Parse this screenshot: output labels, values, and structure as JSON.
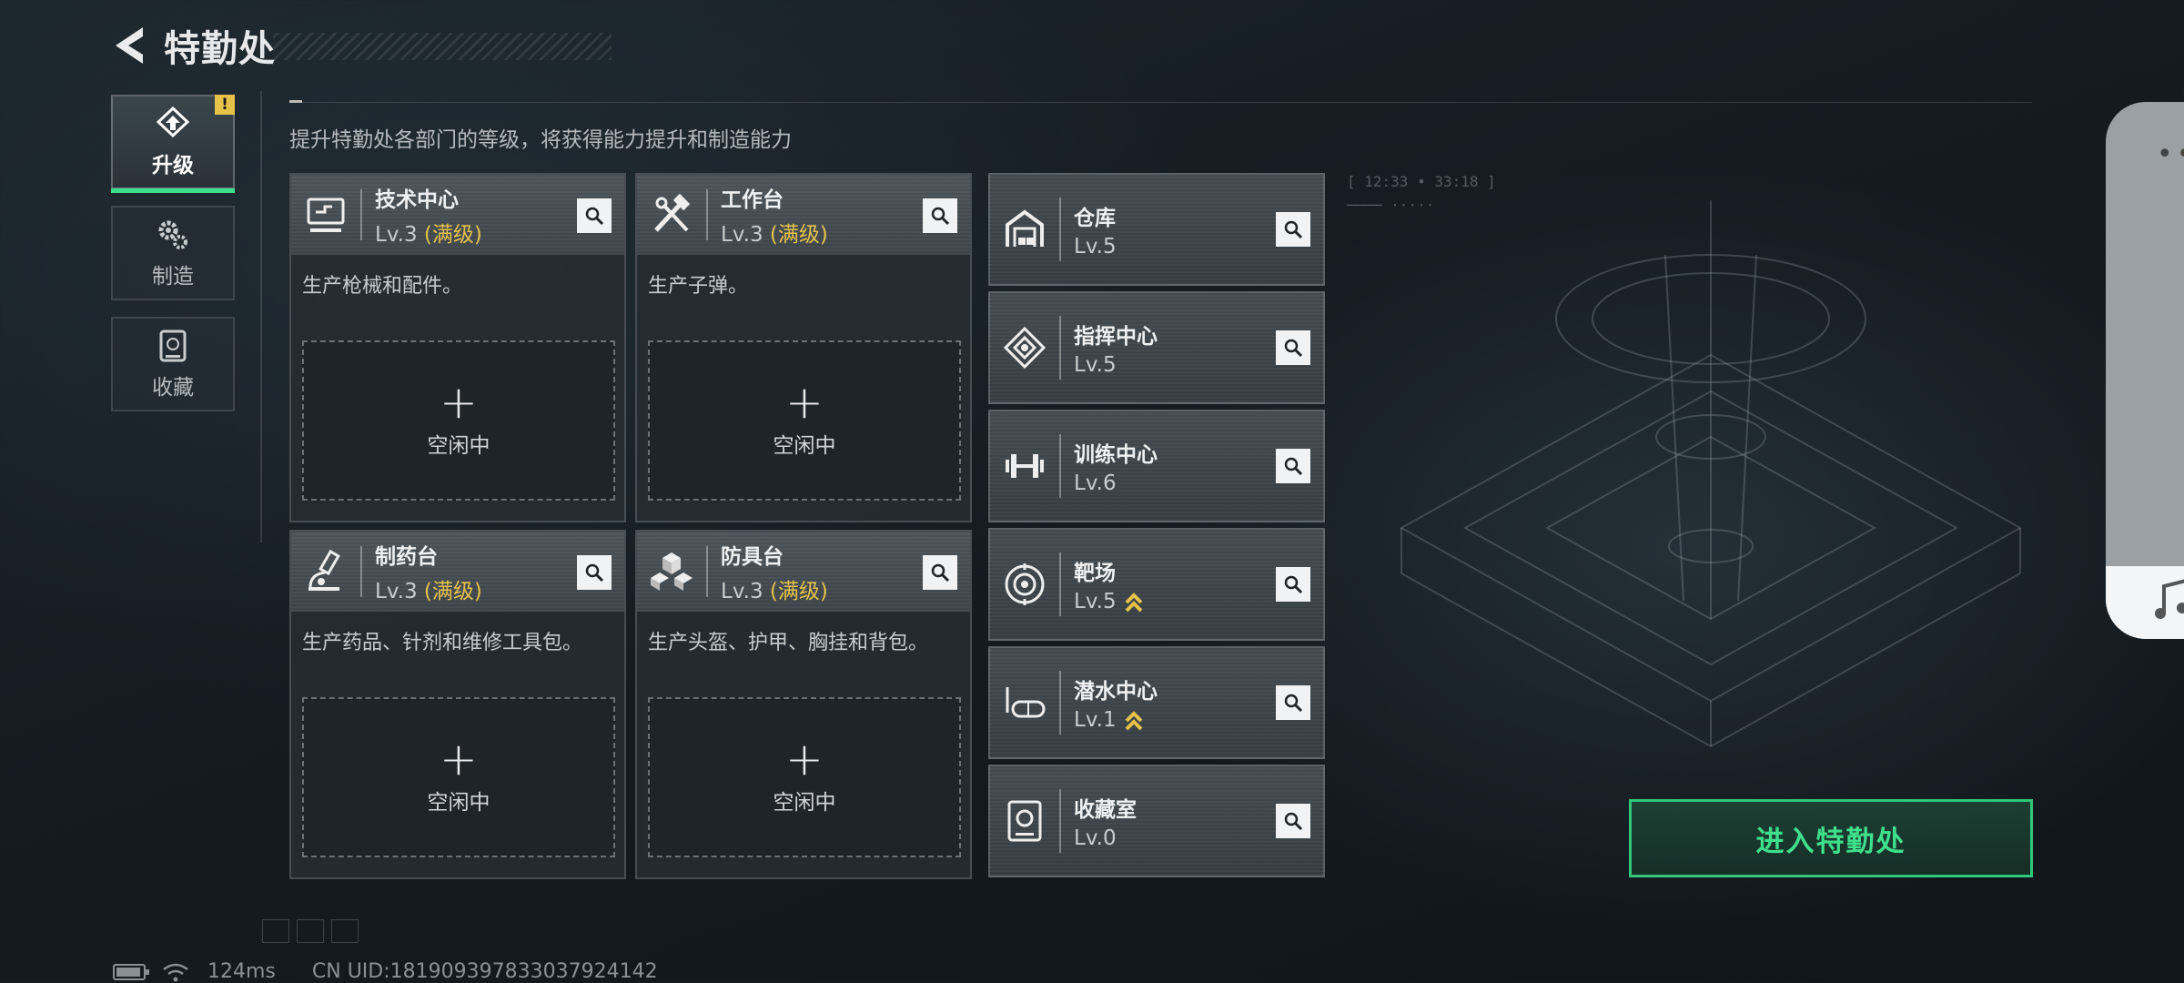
{
  "header": {
    "title": "特勤处"
  },
  "sidebar": {
    "tabs": [
      {
        "label": "升级",
        "icon": "upgrade-icon",
        "active": true,
        "alert": "!"
      },
      {
        "label": "制造",
        "icon": "gears-icon",
        "active": false
      },
      {
        "label": "收藏",
        "icon": "collection-icon",
        "active": false
      }
    ]
  },
  "subtitle": "提升特勤处各部门的等级，将获得能力提升和制造能力",
  "departments": [
    {
      "name": "技术中心",
      "level": "Lv.3",
      "max_tag": "(满级)",
      "desc": "生产枪械和配件。",
      "slot_status": "空闲中",
      "icon": "tech-center-icon"
    },
    {
      "name": "工作台",
      "level": "Lv.3",
      "max_tag": "(满级)",
      "desc": "生产子弹。",
      "slot_status": "空闲中",
      "icon": "workbench-icon"
    },
    {
      "name": "制药台",
      "level": "Lv.3",
      "max_tag": "(满级)",
      "desc": "生产药品、针剂和维修工具包。",
      "slot_status": "空闲中",
      "icon": "pharmacy-icon"
    },
    {
      "name": "防具台",
      "level": "Lv.3",
      "max_tag": "(满级)",
      "desc": "生产头盔、护甲、胸挂和背包。",
      "slot_status": "空闲中",
      "icon": "armor-bench-icon"
    }
  ],
  "facilities": [
    {
      "name": "仓库",
      "level": "Lv.5",
      "upgradeable": false,
      "icon": "warehouse-icon"
    },
    {
      "name": "指挥中心",
      "level": "Lv.5",
      "upgradeable": false,
      "icon": "command-center-icon"
    },
    {
      "name": "训练中心",
      "level": "Lv.6",
      "upgradeable": false,
      "icon": "training-center-icon"
    },
    {
      "name": "靶场",
      "level": "Lv.5",
      "upgradeable": true,
      "icon": "shooting-range-icon"
    },
    {
      "name": "潜水中心",
      "level": "Lv.1",
      "upgradeable": true,
      "icon": "diving-center-icon"
    },
    {
      "name": "收藏室",
      "level": "Lv.0",
      "upgradeable": false,
      "icon": "collection-room-icon"
    }
  ],
  "enter_button": "进入特勤处",
  "status_bar": {
    "ping": "124ms",
    "uid": "CN UID:181909397833037924142"
  },
  "colors": {
    "accent_green": "#3fe08c",
    "max_yellow": "#e6c24a"
  }
}
